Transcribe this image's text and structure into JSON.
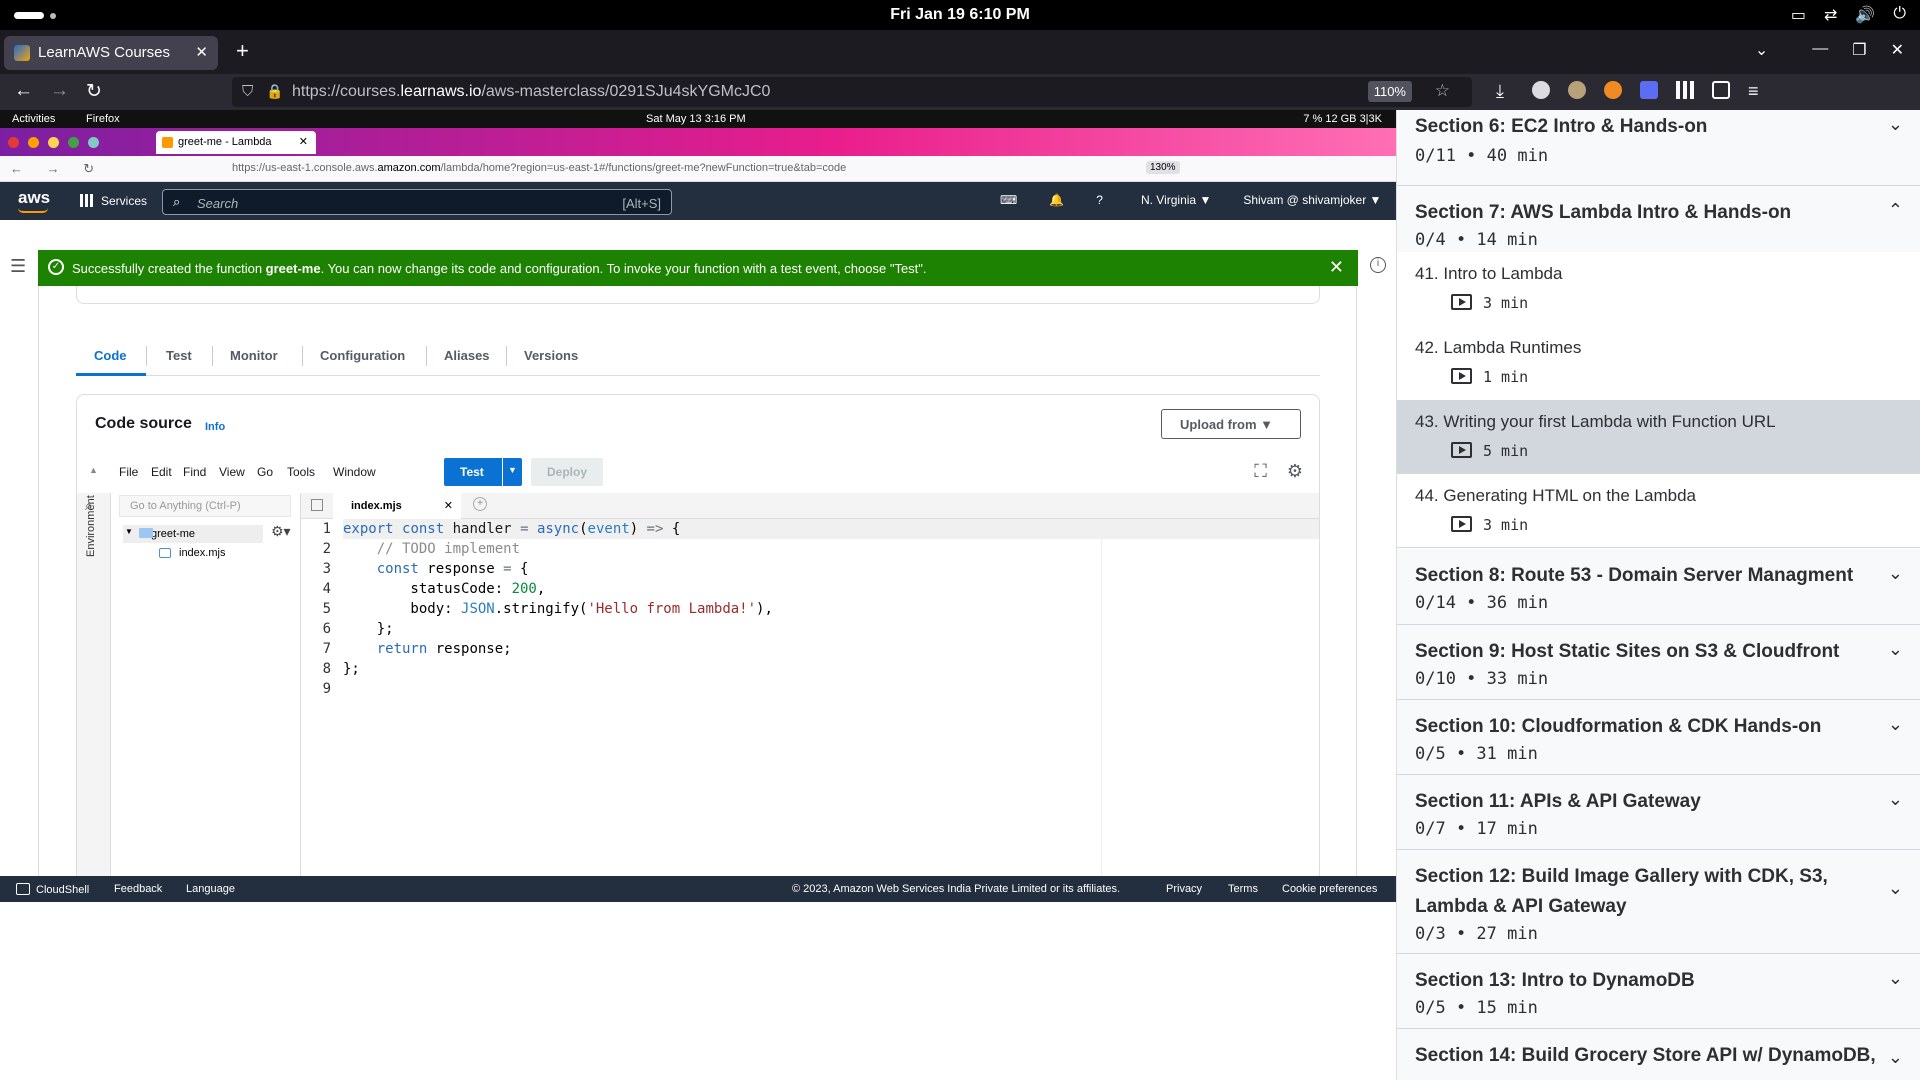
{
  "os": {
    "datetime": "Fri Jan 19   6:10 PM"
  },
  "browser": {
    "tab_title": "LearnAWS Courses",
    "url_prefix": "https://courses.",
    "url_domain": "learnaws.io",
    "url_path": "/aws-masterclass/0291SJu4skYGMcJC0",
    "zoom": "110%"
  },
  "inner": {
    "activities": "Activities",
    "app": "Firefox",
    "clock": "Sat May 13   3:16 PM",
    "stats": "7 %   12 GB   3|3K",
    "tab_title": "greet-me - Lambda",
    "url_prefix": "https://us-east-1.console.aws.",
    "url_domain": "amazon.com",
    "url_path": "/lambda/home?region=us-east-1#/functions/greet-me?newFunction=true&tab=code",
    "zoom": "130%"
  },
  "aws": {
    "logo": "aws",
    "services": "Services",
    "search_placeholder": "Search",
    "search_kbd": "[Alt+S]",
    "region": "N. Virginia ▼",
    "user": "Shivam @ shivamjoker ▼"
  },
  "banner": {
    "pre": "Successfully created the function ",
    "name": "greet-me",
    "post": ". You can now change its code and configuration. To invoke your function with a test event, choose \"Test\"."
  },
  "tabs": [
    "Code",
    "Test",
    "Monitor",
    "Configuration",
    "Aliases",
    "Versions"
  ],
  "code_source": {
    "title": "Code source",
    "info": "Info",
    "upload": "Upload from ▼",
    "menu": [
      "File",
      "Edit",
      "Find",
      "View",
      "Go",
      "Tools",
      "Window"
    ],
    "test": "Test",
    "deploy": "Deploy",
    "goto_placeholder": "Go to Anything (Ctrl-P)",
    "env_label": "Environment",
    "folder": "greet-me",
    "file": "index.mjs",
    "open_tab": "index.mjs"
  },
  "footer": {
    "cloudshell": "CloudShell",
    "feedback": "Feedback",
    "language": "Language",
    "copyright": "© 2023, Amazon Web Services India Private Limited or its affiliates.",
    "privacy": "Privacy",
    "terms": "Terms",
    "cookies": "Cookie preferences"
  },
  "course": {
    "sections": [
      {
        "title": "Section 6: EC2 Intro & Hands-on",
        "meta": "0/11 • 40 min",
        "expanded": false
      },
      {
        "title": "Section 7: AWS Lambda Intro & Hands-on",
        "meta": "0/4 • 14 min",
        "expanded": true
      },
      {
        "title": "Section 8: Route 53 - Domain Server Managment",
        "meta": "0/14 • 36 min",
        "expanded": false
      },
      {
        "title": "Section 9: Host Static Sites on S3 & Cloudfront",
        "meta": "0/10 • 33 min",
        "expanded": false
      },
      {
        "title": "Section 10: Cloudformation & CDK Hands-on",
        "meta": "0/5 • 31 min",
        "expanded": false
      },
      {
        "title": "Section 11: APIs & API Gateway",
        "meta": "0/7 • 17 min",
        "expanded": false
      },
      {
        "title": "Section 12: Build Image Gallery with CDK, S3, Lambda & API Gateway",
        "meta": "0/3 • 27 min",
        "expanded": false
      },
      {
        "title": "Section 13: Intro to DynamoDB",
        "meta": "0/5 • 15 min",
        "expanded": false
      },
      {
        "title": "Section 14: Build Grocery Store API w/ DynamoDB,",
        "meta": "",
        "expanded": false
      }
    ],
    "lectures": [
      {
        "title": "41.  Intro to Lambda",
        "duration": "3 min"
      },
      {
        "title": "42.  Lambda Runtimes",
        "duration": "1 min"
      },
      {
        "title": "43.  Writing your first Lambda with Function URL",
        "duration": "5 min",
        "selected": true
      },
      {
        "title": "44.  Generating HTML on the Lambda",
        "duration": "3 min"
      }
    ]
  },
  "colors": {
    "aws_nav": "#232f3e",
    "success": "#1d8102",
    "aws_blue": "#0972d3",
    "aws_orange": "#ff9900"
  }
}
